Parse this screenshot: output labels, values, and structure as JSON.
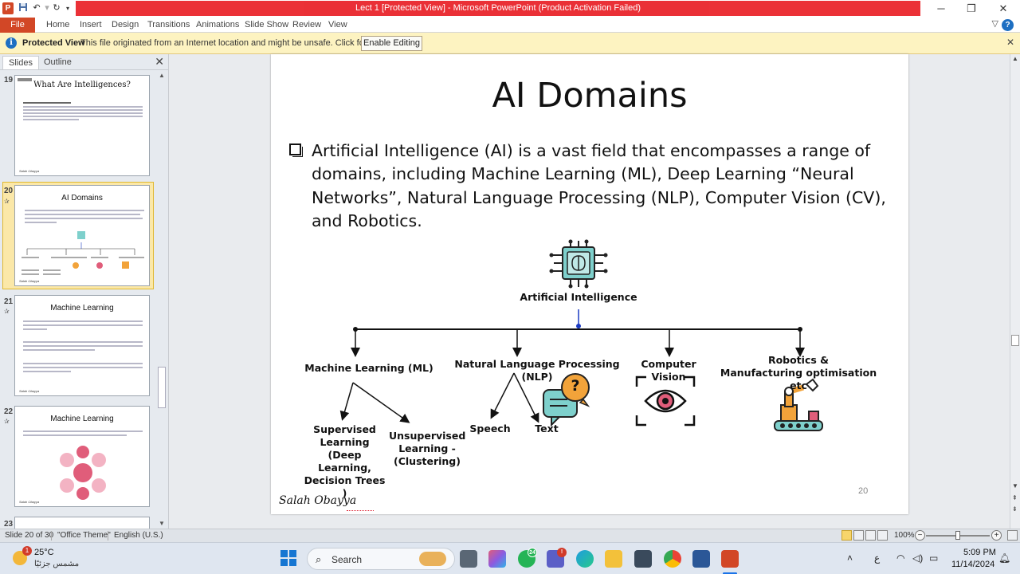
{
  "window": {
    "title": "Lect 1 [Protected View] - Microsoft PowerPoint (Product Activation Failed)",
    "app_icon": "P",
    "controls": {
      "minimize": "─",
      "maximize": "❐",
      "close": "✕"
    }
  },
  "ribbon": {
    "file_tab": "File",
    "tabs": [
      "Home",
      "Insert",
      "Design",
      "Transitions",
      "Animations",
      "Slide Show",
      "Review",
      "View"
    ],
    "help": "?"
  },
  "protected_view": {
    "label": "Protected View",
    "message": "This file originated from an Internet location and might be unsafe. Click for more details.",
    "button": "Enable Editing",
    "info": "i",
    "close": "✕"
  },
  "left_pane": {
    "tabs": {
      "slides": "Slides",
      "outline": "Outline"
    },
    "close": "✕",
    "thumbnails": [
      {
        "num": "19",
        "title": "What Are Intelligences?",
        "signature": "Salah Obayya"
      },
      {
        "num": "20",
        "title": "AI Domains",
        "signature": "Salah Obayya"
      },
      {
        "num": "21",
        "title": "Machine Learning",
        "signature": "Salah Obayya"
      },
      {
        "num": "22",
        "title": "Machine Learning",
        "signature": "Salah Obayya"
      },
      {
        "num": "23",
        "title": ""
      }
    ]
  },
  "slide": {
    "title": "AI Domains",
    "bullet": "Artificial Intelligence (AI) is a vast field that encompasses a range of domains, including Machine Learning (ML), Deep Learning “Neural Networks”, Natural Language Processing (NLP), Computer Vision (CV), and Robotics.",
    "diagram": {
      "root": "Artificial Intelligence",
      "ml": "Machine Learning (ML)",
      "nlp": "Natural Language Processing (NLP)",
      "cv": "Computer Vision",
      "robotics_line1": "Robotics  &",
      "robotics_line2": "Manufacturing optimisation etc",
      "supervised_line1": "Supervised",
      "supervised_line2": "Learning",
      "supervised_line3": "(Deep Learning,",
      "supervised_line4": "Decision Trees )",
      "unsupervised_line1": "Unsupervised",
      "unsupervised_line2": "Learning -",
      "unsupervised_line3": "(Clustering)",
      "speech": "Speech",
      "text": "Text",
      "question_mark": "?"
    },
    "number": "20",
    "signature": "Salah Obayya"
  },
  "status_bar": {
    "slide_info": "Slide 20 of 30",
    "theme": "\"Office Theme\"",
    "language": "English (U.S.)",
    "zoom": "100%",
    "zoom_out": "−",
    "zoom_in": "+"
  },
  "taskbar": {
    "weather_temp": "25°C",
    "weather_desc": "مشمس جزئيًا",
    "weather_badge": "1",
    "search_label": "Search",
    "whatsapp_badge": "24",
    "teams_badge": "!",
    "tray_lang": "ع",
    "time": "5:09 PM",
    "date": "11/14/2024"
  },
  "colors": {
    "ppt_orange": "#d24726",
    "title_strip_red": "#e8141b",
    "protected_view_bg": "#fdf3c1",
    "selected_thumb": "#fbe8a8",
    "diagram_teal": "#7ed0cc",
    "diagram_orange": "#f2a33a",
    "diagram_pink": "#e05d7a",
    "diagram_blue": "#1a3ac2"
  }
}
